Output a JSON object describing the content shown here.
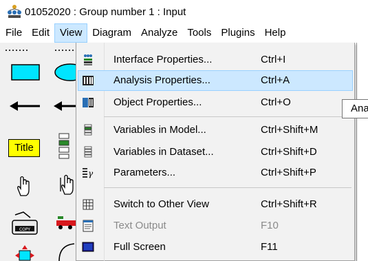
{
  "window": {
    "title": "01052020 : Group number 1 : Input"
  },
  "menubar": {
    "items": [
      {
        "label": "File"
      },
      {
        "label": "Edit"
      },
      {
        "label": "View",
        "active": true
      },
      {
        "label": "Diagram"
      },
      {
        "label": "Analyze"
      },
      {
        "label": "Tools"
      },
      {
        "label": "Plugins"
      },
      {
        "label": "Help"
      }
    ]
  },
  "toolbox": {
    "title_tool_label": "Title",
    "tools": [
      "dotted-line-icon",
      "rectangle-icon",
      "ellipse-icon",
      "single-arrow-icon",
      "double-arrow-icon",
      "title-icon",
      "variable-list-icon",
      "hand-icon",
      "multi-hand-icon",
      "copy-icon",
      "truck-icon",
      "move-icon",
      "shape-icon"
    ]
  },
  "view_menu": {
    "items": [
      {
        "label": "Interface Properties...",
        "shortcut": "Ctrl+I",
        "icon": "interface-properties-icon"
      },
      {
        "label": "Analysis Properties...",
        "shortcut": "Ctrl+A",
        "icon": "analysis-properties-icon",
        "highlighted": true
      },
      {
        "label": "Object Properties...",
        "shortcut": "Ctrl+O",
        "icon": "object-properties-icon"
      },
      {
        "label": "Variables in Model...",
        "shortcut": "Ctrl+Shift+M",
        "icon": "variables-model-icon"
      },
      {
        "label": "Variables in Dataset...",
        "shortcut": "Ctrl+Shift+D",
        "icon": "variables-dataset-icon"
      },
      {
        "label": "Parameters...",
        "shortcut": "Ctrl+Shift+P",
        "icon": "parameters-icon"
      },
      {
        "label": "Switch to Other View",
        "shortcut": "Ctrl+Shift+R",
        "icon": "switch-view-icon"
      },
      {
        "label": "Text Output",
        "shortcut": "F10",
        "icon": "text-output-icon",
        "disabled": true
      },
      {
        "label": "Full Screen",
        "shortcut": "F11",
        "icon": "full-screen-icon"
      }
    ]
  },
  "tooltip": {
    "text": "Ana"
  },
  "colors": {
    "highlight": "#cce8ff",
    "highlight_border": "#99d1ff",
    "toolbox_bg": "#f0f0f0",
    "menu_bg": "#f2f2f2"
  }
}
